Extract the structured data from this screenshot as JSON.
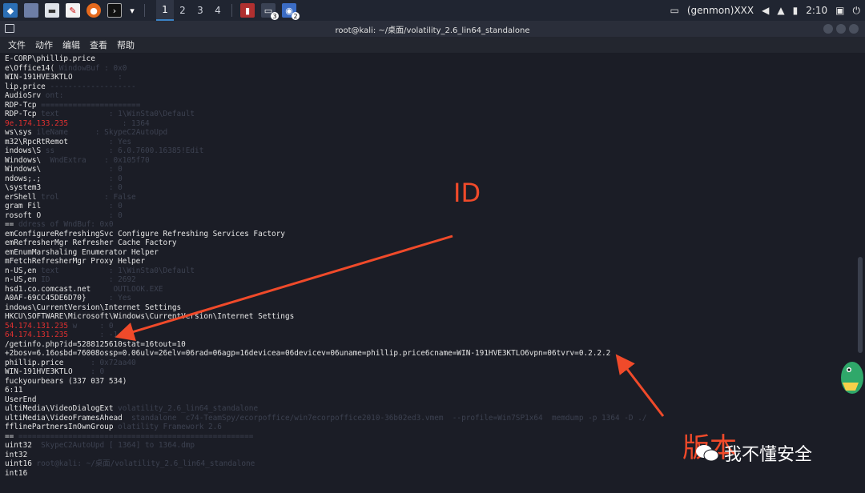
{
  "taskbar": {
    "workspaces": [
      "1",
      "2",
      "3",
      "4"
    ],
    "active_workspace": "1",
    "badge1": "3",
    "badge2": "2",
    "user_label": "(genmon)XXX",
    "clock": "2:10"
  },
  "window": {
    "title": "root@kali: ~/桌面/volatility_2.6_lin64_standalone"
  },
  "menu": [
    "文件",
    "动作",
    "编辑",
    "查看",
    "帮助"
  ],
  "terminal_lines": [
    {
      "t": "E-CORP\\phillip.price",
      "g": ""
    },
    {
      "t": "e\\Office14(",
      "g": "WindowBuf : 0x0"
    },
    {
      "t": "WIN-191HVE3KTLO",
      "g": "         :"
    },
    {
      "t": "lip.price",
      "g": "-------------------"
    },
    {
      "t": "AudioSrv",
      "g": "ont:"
    },
    {
      "t": "RDP-Tcp",
      "g": "======================"
    },
    {
      "t": "RDP-Tcp",
      "g": "text           : 1\\WinSta0\\Default"
    },
    {
      "t": "9e.174.133.235",
      "g": "           : 1364",
      "red": true
    },
    {
      "t": "ws\\sys",
      "g": "ileName      : SkypeC2AutoUpd"
    },
    {
      "t": "m32\\RpcRtRemot",
      "g": "        : Yes"
    },
    {
      "t": "indows\\S",
      "g": "ss            : 6.0.7600.16385!Edit"
    },
    {
      "t": "Windows\\",
      "g": " WndExtra    : 0x105f70"
    },
    {
      "t": "Windows\\",
      "g": "              : 0"
    },
    {
      "t": "ndows;.;",
      "g": "              : 0"
    },
    {
      "t": "\\system3",
      "g": "              : 0"
    },
    {
      "t": "erShell",
      "g": "trol          : False"
    },
    {
      "t": "gram Fil",
      "g": "              : 0"
    },
    {
      "t": "rosoft O",
      "g": "              : 0"
    },
    {
      "t": "==",
      "g": "ddress of WndBuf: 0x0"
    },
    {
      "t": "emConfigureRefreshingSvc Configure Refreshing Services Factory",
      "g": ""
    },
    {
      "t": "emRefresherMgr Refresher Cache Factory",
      "g": ""
    },
    {
      "t": "emEnumMarshaling Enumerator Helper",
      "g": ""
    },
    {
      "t": "mFetchRefresherMgr Proxy Helper",
      "g": ""
    },
    {
      "t": "n-US,en",
      "g": "text           : 1\\WinSta0\\Default"
    },
    {
      "t": "n-US,en",
      "g": "ID             : 2692"
    },
    {
      "t": "hsd1.co.comcast.net",
      "g": "    OUTLOOK.EXE"
    },
    {
      "t": "A0AF-69CC45DE6D70}",
      "g": "    : Yes"
    },
    {
      "t": "indows\\CurrentVersion\\Internet Settings",
      "g": ""
    },
    {
      "t": "HKCU\\SOFTWARE\\Microsoft\\Windows\\CurrentVersion\\Internet Settings",
      "g": ""
    },
    {
      "t": "54.174.131.235",
      "g": "w     : 0",
      "red": true
    },
    {
      "t": "64.174.131.235",
      "g": "      : -1",
      "red": true
    },
    {
      "t": "/getinfo.php?id=5288125610stat=16tout=10",
      "g": ""
    },
    {
      "t": "+2bosv=6.16osbd=76008ossp=0.06ulv=26elv=06rad=06agp=16devicea=06devicev=06uname=phillip.price6cname=WIN-191HVE3KTLO6vpn=06tvrv=0.2.2.2",
      "g": ""
    },
    {
      "t": "phillip.price",
      "g": "     : 0x72aa40"
    },
    {
      "t": "WIN-191HVE3KTLO",
      "g": "   : 0"
    },
    {
      "t": "fuckyourbears (337 037 534)",
      "g": ""
    },
    {
      "t": "6:11",
      "g": ""
    },
    {
      "t": "UserEnd",
      "g": ""
    },
    {
      "t": "ultiMedia\\VideoDialogExt",
      "g": "volatility_2.6_lin64_standalone"
    },
    {
      "t": "ultiMedia\\VideoFramesAhead",
      "g": " standalone  c74-TeamSpy/ecorpoffice/win7ecorpoffice2010-36b02ed3.vmem  --profile=Win7SP1x64  memdump -p 1364 -D ./"
    },
    {
      "t": "fflinePartnersInOwnGroup",
      "g": "olatility Framework 2.6"
    },
    {
      "t": "==",
      "g": "===================================================="
    },
    {
      "t": "uint32",
      "g": " SkypeC2AutoUpd [ 1364] to 1364.dmp"
    },
    {
      "t": "int32",
      "g": ""
    },
    {
      "t": "uint16",
      "g": "root@kali: ~/桌面/volatility_2.6_lin64_standalone"
    },
    {
      "t": "int16",
      "g": ""
    }
  ],
  "annotations": {
    "id_label": "ID",
    "version_label": "版本"
  },
  "watermark": "我不懂安全",
  "colors": {
    "annotation": "#f04a2a",
    "terminal_bg": "#1b1d26",
    "red_text": "#e03030"
  }
}
